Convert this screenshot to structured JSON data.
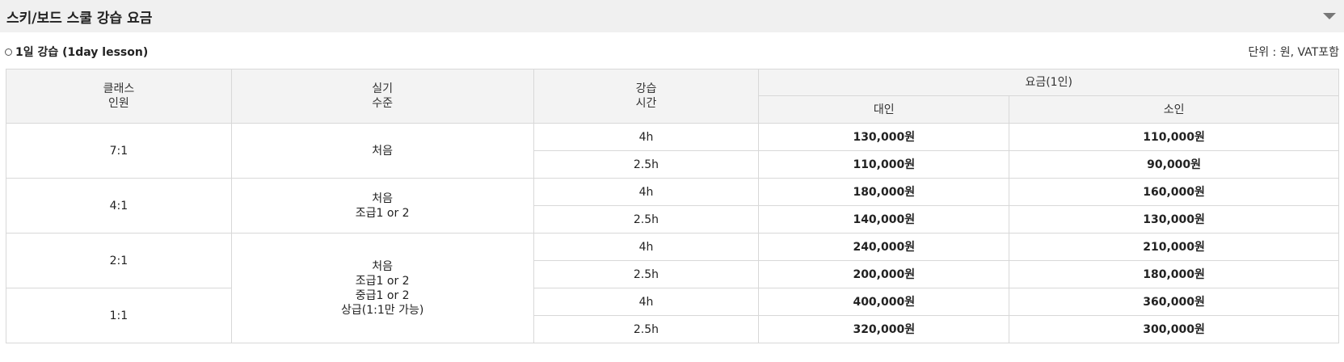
{
  "header": {
    "title": "스키/보드 스쿨 강습 요금",
    "toggle_icon": "chevron-down-icon"
  },
  "section": {
    "title": "1일 강습 (1day lesson)",
    "unit": "단위 : 원, VAT포함"
  },
  "table": {
    "headers": {
      "class_size": [
        "클래스",
        "인원"
      ],
      "skill_level": [
        "실기",
        "수준"
      ],
      "lesson_time": [
        "강습",
        "시간"
      ],
      "fee": "요금(1인)",
      "adult": "대인",
      "child": "소인"
    },
    "groups": [
      {
        "class": "7:1",
        "levels": [
          "처음"
        ],
        "rows": [
          {
            "time": "4h",
            "adult": "130,000원",
            "child": "110,000원"
          },
          {
            "time": "2.5h",
            "adult": "110,000원",
            "child": "90,000원"
          }
        ]
      },
      {
        "class": "4:1",
        "levels": [
          "처음",
          "조급1 or 2"
        ],
        "rows": [
          {
            "time": "4h",
            "adult": "180,000원",
            "child": "160,000원"
          },
          {
            "time": "2.5h",
            "adult": "140,000원",
            "child": "130,000원"
          }
        ]
      },
      {
        "class": "2:1",
        "rows": [
          {
            "time": "4h",
            "adult": "240,000원",
            "child": "210,000원"
          },
          {
            "time": "2.5h",
            "adult": "200,000원",
            "child": "180,000원"
          }
        ]
      },
      {
        "class": "1:1",
        "rows": [
          {
            "time": "4h",
            "adult": "400,000원",
            "child": "360,000원"
          },
          {
            "time": "2.5h",
            "adult": "320,000원",
            "child": "300,000원"
          }
        ]
      }
    ],
    "shared_levels_private": [
      "처음",
      "조급1 or 2",
      "중급1 or 2",
      "상급(1:1만 가능)"
    ]
  }
}
